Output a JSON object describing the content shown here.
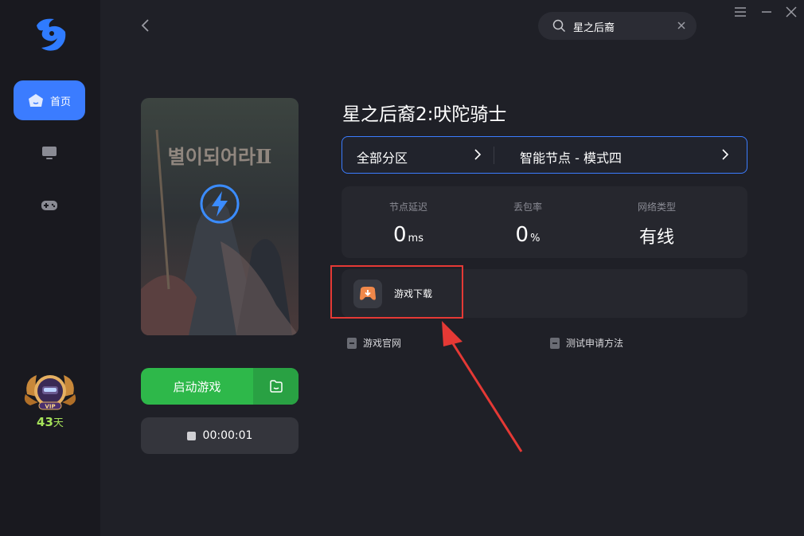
{
  "sidebar": {
    "home_label": "首页",
    "vip": {
      "badge_text": "VIP",
      "days": "43",
      "unit": "天"
    }
  },
  "search": {
    "value": "星之后裔"
  },
  "game": {
    "title": "星之后裔2:吠陀骑士",
    "cover_text": "별이되어라Ⅱ"
  },
  "zone": {
    "left_label": "全部分区",
    "right_label": "智能节点 - 模式四"
  },
  "stats": [
    {
      "label": "节点延迟",
      "value": "0",
      "unit": "ms"
    },
    {
      "label": "丢包率",
      "value": "0",
      "unit": "%"
    },
    {
      "label": "网络类型",
      "value": "有线",
      "unit": ""
    }
  ],
  "download": {
    "label": "游戏下载"
  },
  "links": {
    "official": "游戏官网",
    "test": "测试申请方法"
  },
  "actions": {
    "launch_label": "启动游戏",
    "timer": "00:00:01"
  },
  "colors": {
    "accent": "#3b7cff",
    "launch_green": "#2eb84a",
    "highlight_red": "#e53935",
    "vip_green": "#a6e35a"
  }
}
